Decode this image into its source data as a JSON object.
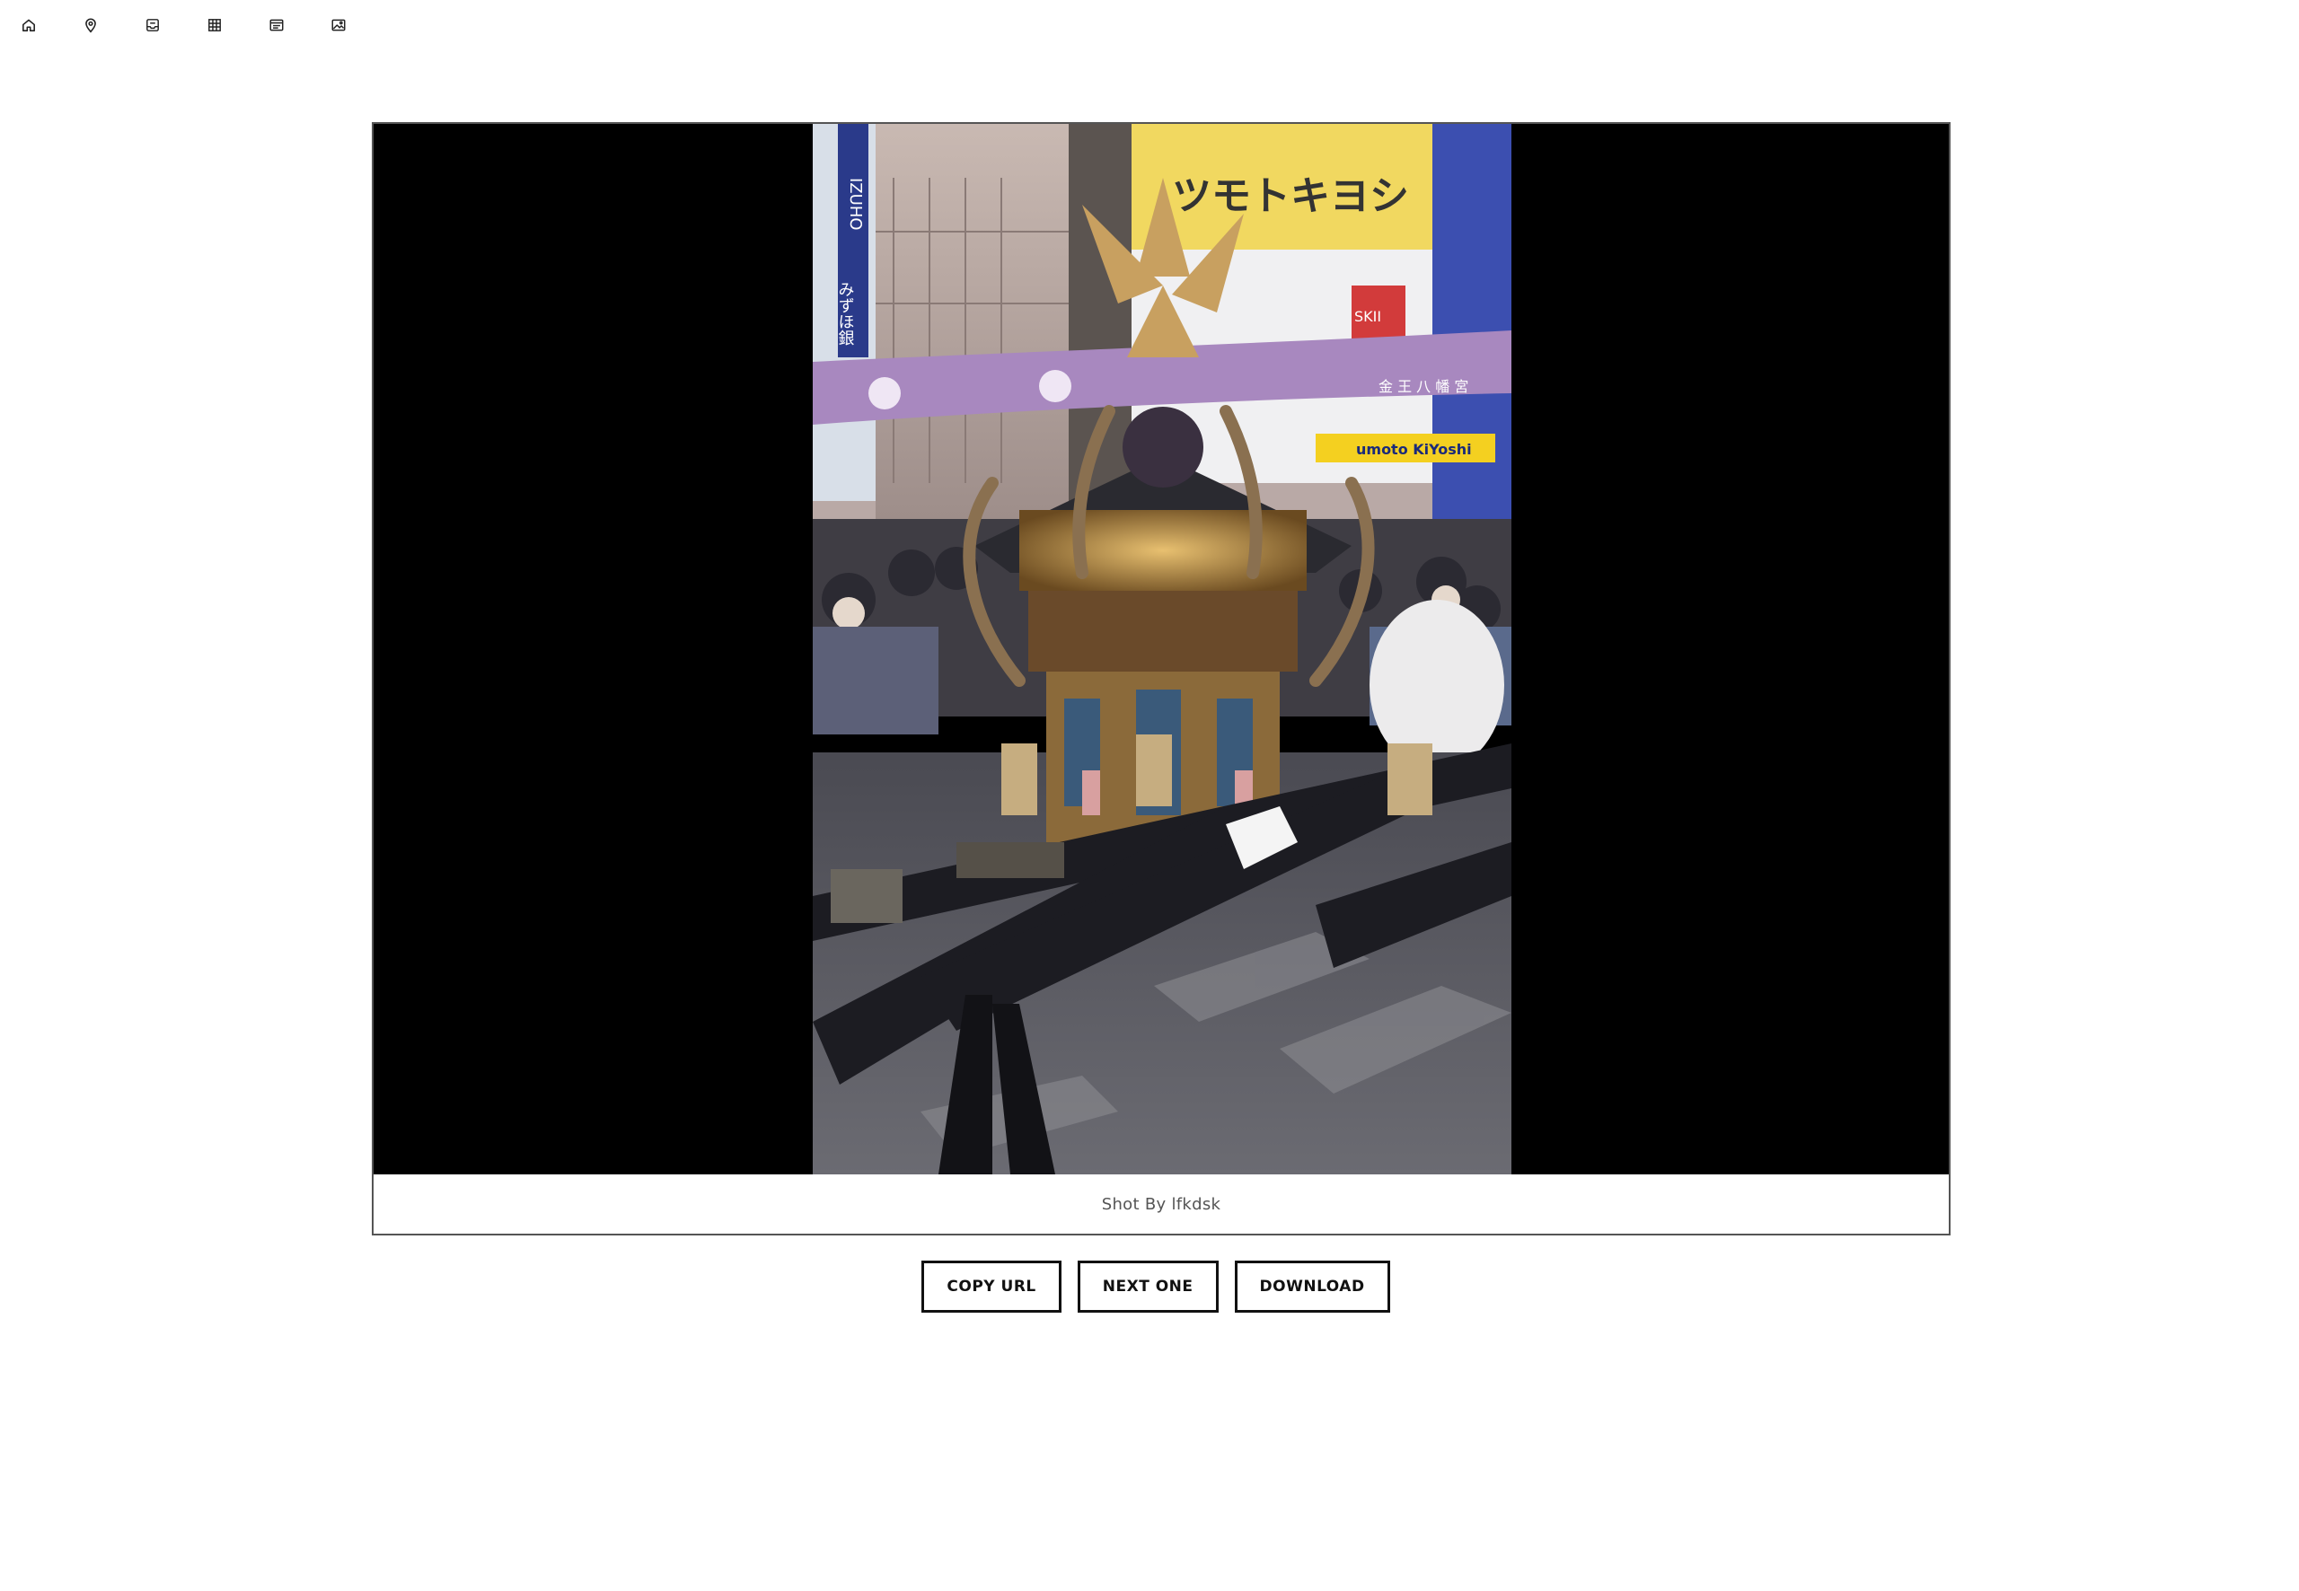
{
  "nav": {
    "icons": [
      "home-icon",
      "location-pin-icon",
      "inbox-icon",
      "grid-table-icon",
      "list-card-icon",
      "image-icon"
    ]
  },
  "photo": {
    "caption": "Shot By lfkdsk",
    "sign_text": "ツモトキヨシ",
    "sign_small": "SKII",
    "banner_text": "金 王 八 幡 宮",
    "store_text": "umoto KiYoshi",
    "bank_text": "みずほ銀",
    "bank_latin": "IZUHO",
    "colors": {
      "viewer_bg": "#000000",
      "border": "#555555"
    }
  },
  "actions": {
    "copy_url": "COPY URL",
    "next_one": "NEXT ONE",
    "download": "DOWNLOAD"
  }
}
